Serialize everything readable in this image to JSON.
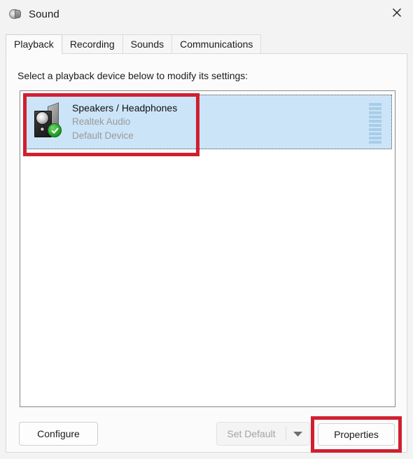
{
  "window": {
    "title": "Sound",
    "icon": "speaker-icon",
    "close_label": "✕"
  },
  "tabs": [
    {
      "label": "Playback",
      "active": true
    },
    {
      "label": "Recording",
      "active": false
    },
    {
      "label": "Sounds",
      "active": false
    },
    {
      "label": "Communications",
      "active": false
    }
  ],
  "main": {
    "prompt": "Select a playback device below to modify its settings:",
    "devices": [
      {
        "name": "Speakers / Headphones",
        "driver": "Realtek Audio",
        "status": "Default Device",
        "icon": "speaker-icon",
        "badge": "default-check-icon",
        "selected": true,
        "level_segments": 10
      }
    ]
  },
  "footer": {
    "configure_label": "Configure",
    "set_default_label": "Set Default",
    "set_default_enabled": false,
    "set_default_arrow": "chevron-down-icon",
    "properties_label": "Properties"
  },
  "annotations": {
    "colors": {
      "highlight": "#cf2030",
      "selection": "#cce4f7",
      "meter": "#a8cde8",
      "badge_green": "#29a72c",
      "muted_text": "#9a9a9a"
    }
  }
}
